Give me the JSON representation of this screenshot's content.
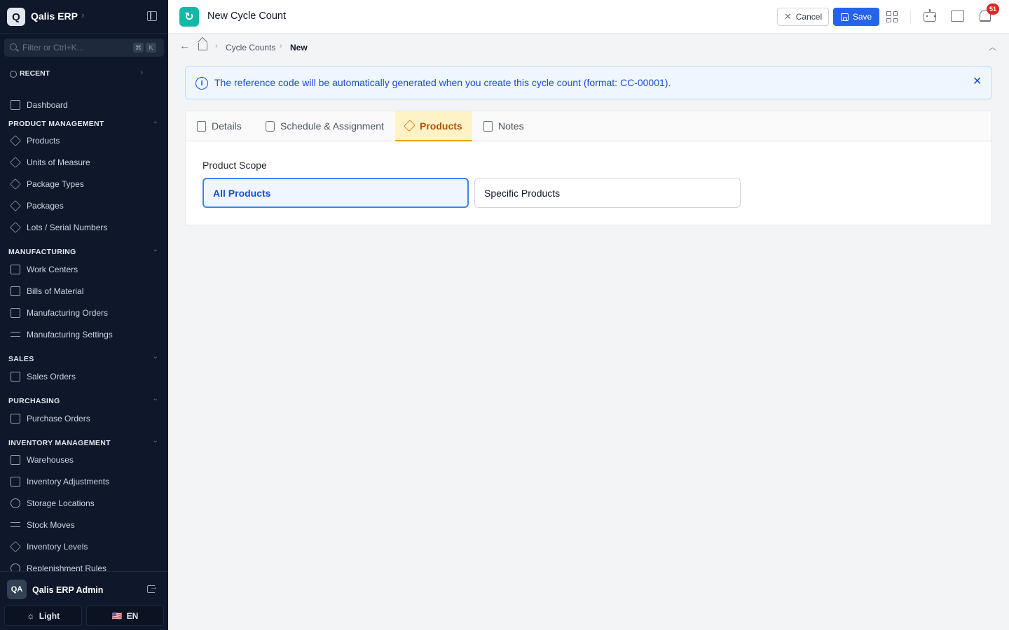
{
  "brand": {
    "logo_letter": "Q",
    "name": "Qalis ERP"
  },
  "search": {
    "placeholder": "Filter or Ctrl+K...",
    "kbd1": "⌘",
    "kbd2": "K"
  },
  "recent": {
    "label": "RECENT"
  },
  "dashboard": {
    "label": "Dashboard"
  },
  "sections": {
    "product_management": {
      "title": "PRODUCT MANAGEMENT",
      "items": [
        "Products",
        "Units of Measure",
        "Package Types",
        "Packages",
        "Lots / Serial Numbers"
      ]
    },
    "manufacturing": {
      "title": "MANUFACTURING",
      "items": [
        "Work Centers",
        "Bills of Material",
        "Manufacturing Orders",
        "Manufacturing Settings"
      ]
    },
    "sales": {
      "title": "SALES",
      "items": [
        "Sales Orders"
      ]
    },
    "purchasing": {
      "title": "PURCHASING",
      "items": [
        "Purchase Orders"
      ]
    },
    "inventory_management": {
      "title": "INVENTORY MANAGEMENT",
      "items": [
        "Warehouses",
        "Inventory Adjustments",
        "Storage Locations",
        "Stock Moves",
        "Inventory Levels",
        "Replenishment Rules"
      ]
    }
  },
  "user": {
    "initials": "QA",
    "name": "Qalis ERP Admin"
  },
  "theme_button": "Light",
  "lang_button": {
    "flag": "🇺🇸",
    "label": "EN"
  },
  "header": {
    "title": "New Cycle Count",
    "cancel": "Cancel",
    "save": "Save",
    "notifications": "51"
  },
  "breadcrumb": {
    "parent": "Cycle Counts",
    "current": "New"
  },
  "alert": {
    "text": "The reference code will be automatically generated when you create this cycle count (format: CC-00001)."
  },
  "tabs": [
    "Details",
    "Schedule & Assignment",
    "Products",
    "Notes"
  ],
  "active_tab": "Products",
  "product_scope": {
    "label": "Product Scope",
    "options": [
      "All Products",
      "Specific Products"
    ],
    "selected": "All Products"
  },
  "colors": {
    "sidebar_bg": "#0f172a",
    "primary": "#2563eb",
    "accent_tab": "#f59e0b",
    "badge": "#dc2626",
    "app_icon": "#14b8a6"
  }
}
